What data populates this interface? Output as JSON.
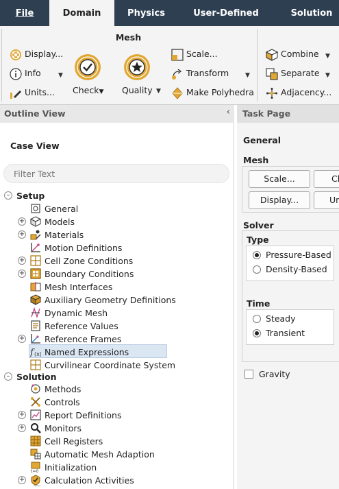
{
  "ribbon": {
    "tabs": [
      {
        "label": "File"
      },
      {
        "label": "Domain",
        "active": true
      },
      {
        "label": "Physics"
      },
      {
        "label": "User-Defined"
      },
      {
        "label": "Solution"
      }
    ],
    "mesh_group": {
      "title": "Mesh",
      "display": "Display...",
      "info": "Info",
      "units": "Units...",
      "check": "Check",
      "quality": "Quality",
      "scale": "Scale...",
      "transform": "Transform",
      "make_polyhedra": "Make Polyhedra"
    },
    "zones_group": {
      "combine": "Combine",
      "separate": "Separate",
      "adjacency": "Adjacency..."
    }
  },
  "outline": {
    "title": "Outline View",
    "case_view": "Case View",
    "filter_placeholder": "Filter Text",
    "setup_label": "Setup",
    "setup_items": [
      "General",
      "Models",
      "Materials",
      "Motion Definitions",
      "Cell Zone Conditions",
      "Boundary Conditions",
      "Mesh Interfaces",
      "Auxiliary Geometry Definitions",
      "Dynamic Mesh",
      "Reference Values",
      "Reference Frames",
      "Named Expressions",
      "Curvilinear Coordinate System"
    ],
    "solution_label": "Solution",
    "solution_items": [
      "Methods",
      "Controls",
      "Report Definitions",
      "Monitors",
      "Cell Registers",
      "Automatic Mesh Adaption",
      "Initialization",
      "Calculation Activities"
    ],
    "selected_item": "Named Expressions"
  },
  "task": {
    "title": "Task Page",
    "general": "General",
    "mesh_label": "Mesh",
    "scale_btn": "Scale...",
    "check_btn": "Ch",
    "display_btn": "Display...",
    "units_btn": "Un",
    "solver_label": "Solver",
    "type_label": "Type",
    "type_options": [
      "Pressure-Based",
      "Density-Based"
    ],
    "type_selected": "Pressure-Based",
    "time_label": "Time",
    "time_options": [
      "Steady",
      "Transient"
    ],
    "time_selected": "Transient",
    "gravity": "Gravity",
    "gravity_checked": false
  },
  "colors": {
    "tab_bar": "#2e3f52",
    "ribbon_bg": "#f4f4f4",
    "selection": "#dbe6f3",
    "icon_gold": "#e1a734"
  }
}
